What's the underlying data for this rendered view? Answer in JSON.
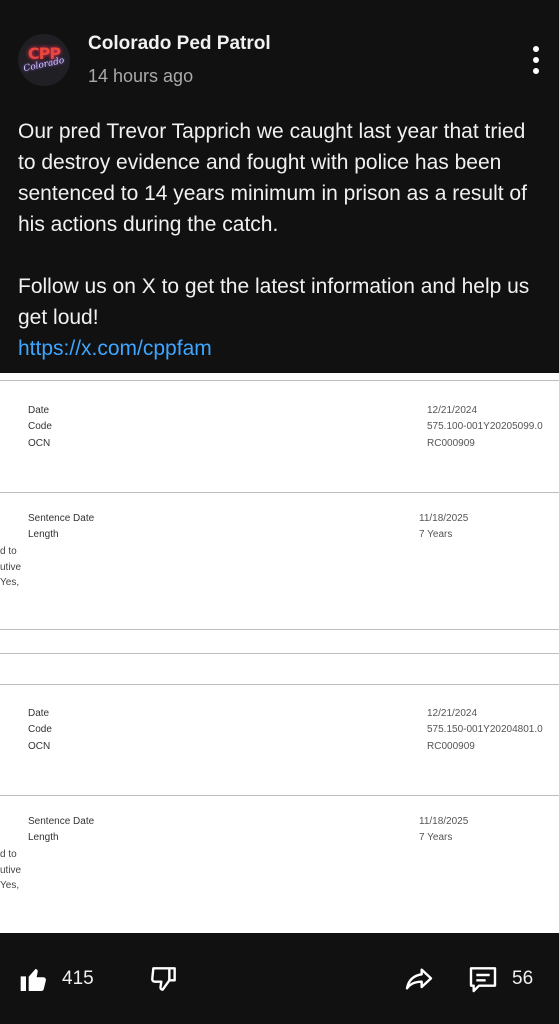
{
  "post": {
    "channel_name": "Colorado Ped Patrol",
    "timestamp": "14 hours ago",
    "avatar_text": "CPP",
    "avatar_script": "Colorado",
    "paragraph1": "Our pred Trevor Tapprich we caught last year that tried to destroy evidence and fought with police has been sentenced to 14 years minimum in prison as a result of his actions during the catch.",
    "paragraph2": "Follow us on X to get the latest information and help us get loud!",
    "link": "https://x.com/cppfam"
  },
  "document": {
    "records": [
      {
        "date_label": "Date",
        "date_value": "12/21/2024",
        "code_label": "Code",
        "code_value": "575.100-001Y20205099.0",
        "ocn_label": "OCN",
        "ocn_value": "RC000909",
        "sentence_date_label": "Sentence Date",
        "sentence_date_value": "11/18/2025",
        "length_label": "Length",
        "length_value": "7 Years",
        "fragments": [
          "d to",
          "utive",
          "Yes,"
        ]
      },
      {
        "date_label": "Date",
        "date_value": "12/21/2024",
        "code_label": "Code",
        "code_value": "575.150-001Y20204801.0",
        "ocn_label": "OCN",
        "ocn_value": "RC000909",
        "sentence_date_label": "Sentence Date",
        "sentence_date_value": "11/18/2025",
        "length_label": "Length",
        "length_value": "7 Years",
        "fragments": [
          "d to",
          "utive",
          "Yes,"
        ]
      }
    ]
  },
  "actions": {
    "like_count": "415",
    "comment_count": "56",
    "like_icon": "thumbs-up-icon",
    "dislike_icon": "thumbs-down-icon",
    "share_icon": "share-icon",
    "comment_icon": "comment-icon",
    "more_icon": "more-vertical-icon"
  }
}
